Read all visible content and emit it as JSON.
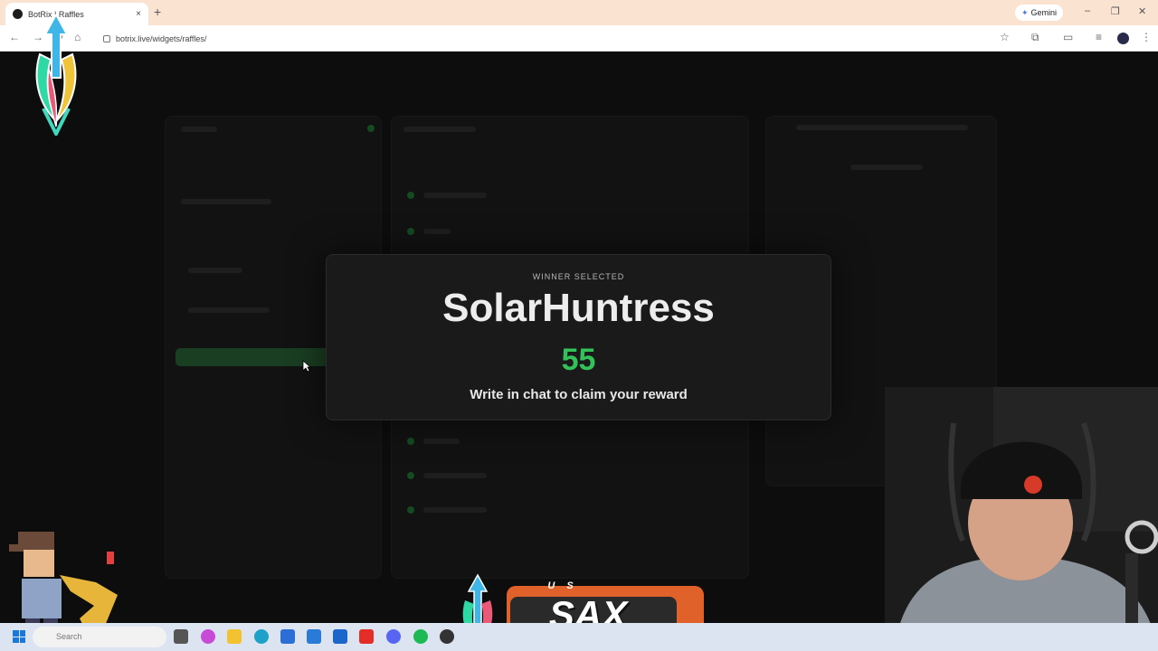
{
  "browser": {
    "tab_title": "BotRix | Raffles",
    "tab_close": "×",
    "new_tab": "+",
    "url": "botrix.live/widgets/raffles/",
    "gemini_label": "Gemini",
    "minimize": "–",
    "restore": "❐",
    "close": "✕"
  },
  "modal": {
    "eyebrow": "WINNER SELECTED",
    "winner_name": "SolarHuntress",
    "number": "55",
    "claim_text": "Write in chat to claim your reward"
  },
  "overlay": {
    "sax_small": "U S",
    "sax_big": "SAX"
  },
  "taskbar": {
    "search_placeholder": "Search"
  },
  "colors": {
    "accent_green": "#33c25a",
    "tabbar_bg": "#fbe3d2",
    "sax_orange": "#e0622a"
  }
}
